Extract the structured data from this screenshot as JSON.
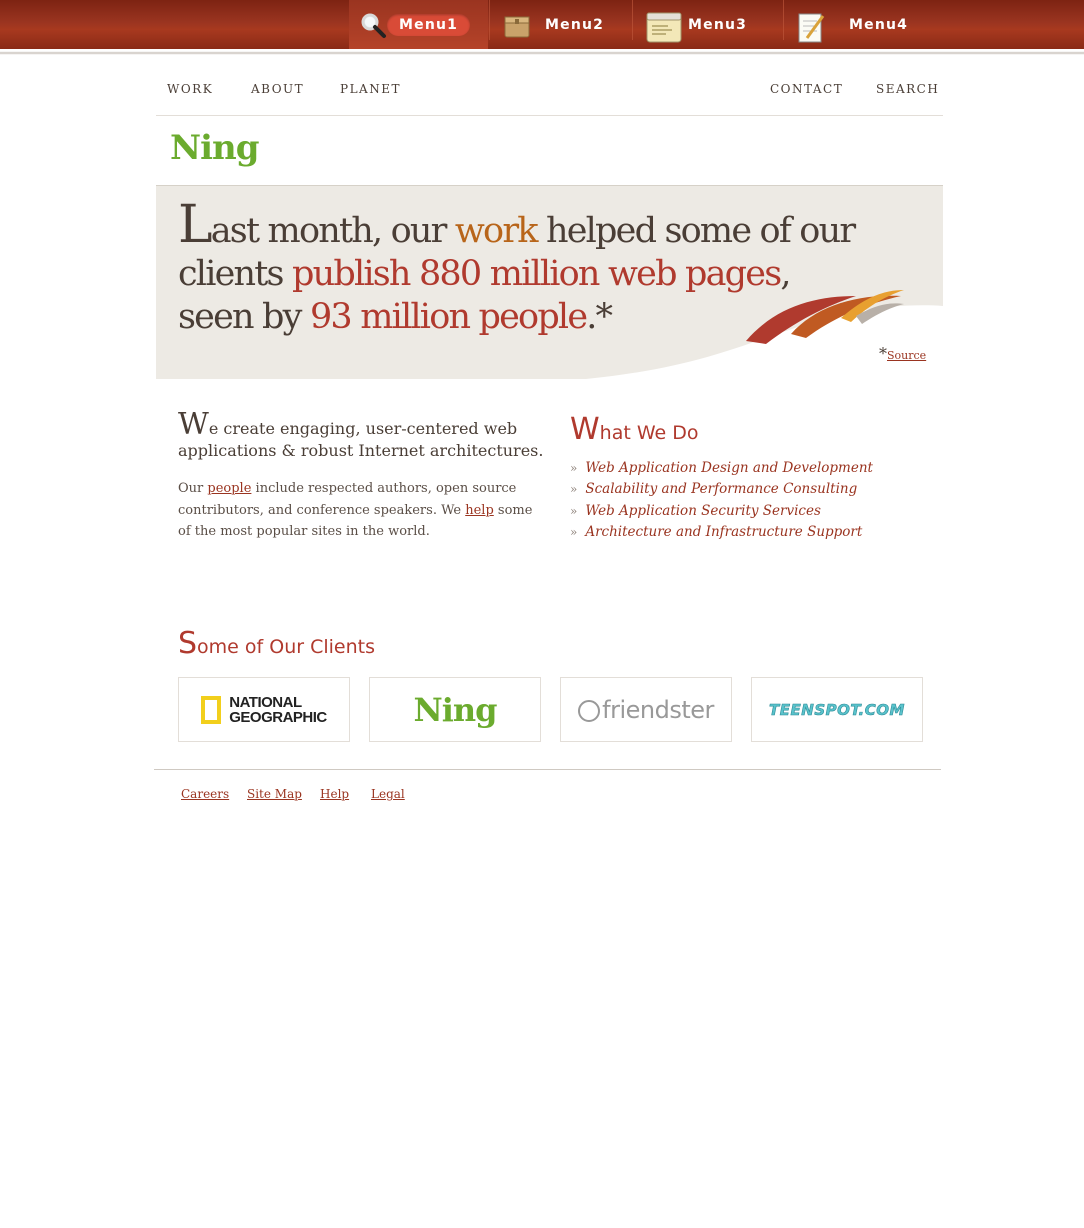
{
  "topmenu": {
    "items": [
      {
        "label": "Menu1",
        "icon": "magnifier-icon"
      },
      {
        "label": "Menu2",
        "icon": "box-icon"
      },
      {
        "label": "Menu3",
        "icon": "calendar-icon"
      },
      {
        "label": "Menu4",
        "icon": "notepad-icon"
      }
    ]
  },
  "nav": {
    "left": [
      "WORK",
      "ABOUT",
      "PLANET"
    ],
    "right": [
      "CONTACT",
      "SEARCH"
    ]
  },
  "logo": "Ning",
  "hero": {
    "line1_cap": "L",
    "line1_a": "ast month, our ",
    "line1_work": "work",
    "line1_b": " helped some of our",
    "line2_a": "clients ",
    "line2_hl": "publish 880 million web pages",
    "line2_b": ",",
    "line3_a": "seen by ",
    "line3_hl": "93 million people",
    "line3_b": ".*",
    "source_star": "*",
    "source_label": "Source"
  },
  "intro": {
    "lead_cap": "W",
    "lead_rest": "e create engaging, user-centered web applications & robust Internet architectures.",
    "p_a": "Our ",
    "p_people": "people",
    "p_b": " include respected authors, open source contributors, and conference speakers. We ",
    "p_help": "help",
    "p_c": " some of the most popular sites in the world."
  },
  "what_we_do": {
    "title_cap": "W",
    "title_rest": "hat We Do",
    "items": [
      "Web Application Design and Development",
      "Scalability and Performance Consulting",
      "Web Application Security Services",
      "Architecture and Infrastructure Support"
    ]
  },
  "clients": {
    "title_cap": "S",
    "title_rest": "ome of Our Clients",
    "natgeo_line1": "NATIONAL",
    "natgeo_line2": "GEOGRAPHIC",
    "ning": "Ning",
    "friendster": "friendster",
    "teenspot": "TEENSPOT.COM"
  },
  "footer": [
    "Careers",
    "Site Map",
    "Help",
    "Legal"
  ],
  "colors": {
    "topbar": "#9a3420",
    "accent_red": "#b03a2e",
    "accent_orange": "#b8651a",
    "ning_green": "#6bab2e",
    "hero_bg": "#edeae4"
  }
}
